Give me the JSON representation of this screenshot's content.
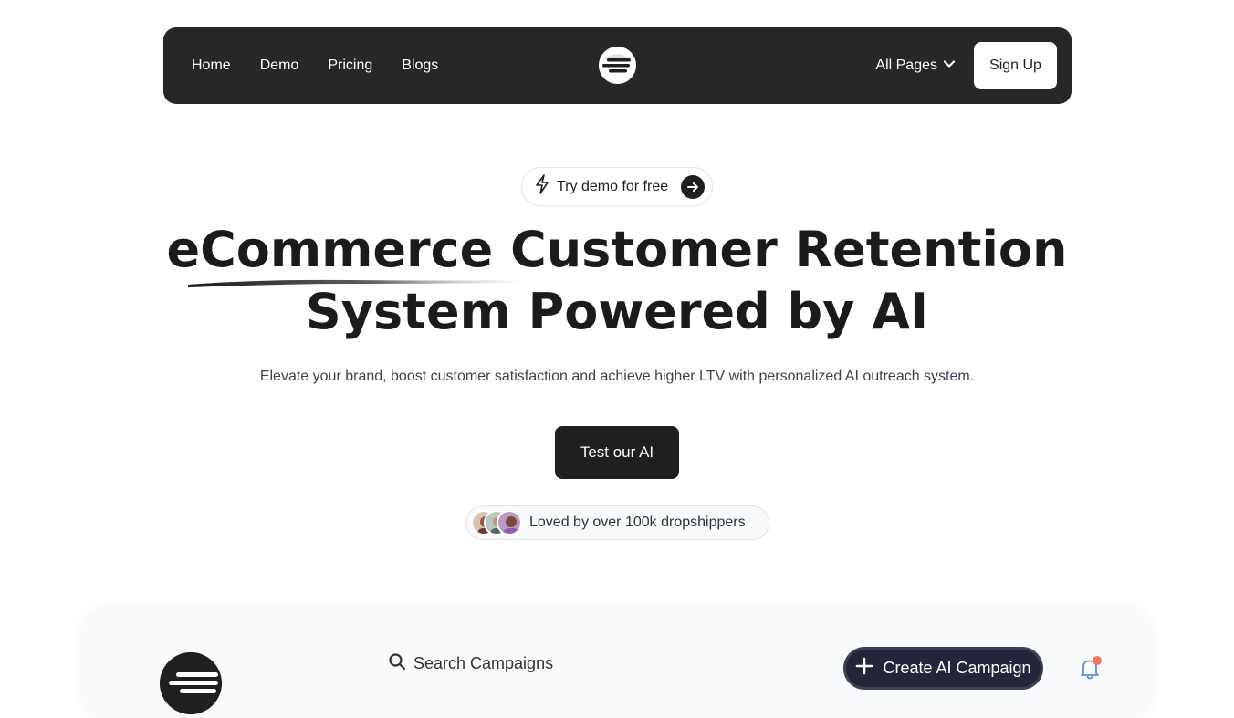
{
  "nav": {
    "links": [
      "Home",
      "Demo",
      "Pricing",
      "Blogs"
    ],
    "all_pages_label": "All Pages",
    "signup_label": "Sign Up"
  },
  "hero": {
    "demo_pill_label": "Try demo for free",
    "headline_line1": "eCommerce Customer Retention",
    "headline_line2": "System Powered by AI",
    "subtitle": "Elevate your brand, boost customer satisfaction and achieve higher LTV with personalized AI outreach system.",
    "cta_label": "Test our AI",
    "social_proof": "Loved by over 100k dropshippers"
  },
  "dashboard": {
    "search_placeholder": "Search Campaigns",
    "create_label": "Create AI Campaign"
  },
  "colors": {
    "nav_bg": "#272727",
    "accent_dark": "#1f1f1f",
    "create_btn_bg": "#222638",
    "notification_dot": "#f2785c",
    "bell_stroke": "#5b8fd6"
  },
  "icons": {
    "nav_logo": "brand-logo-icon",
    "all_pages": "chevron-down-icon",
    "demo_pill_left": "lightning-icon",
    "demo_pill_right": "arrow-right-icon",
    "search": "search-icon",
    "create": "plus-icon",
    "notifications": "bell-icon"
  }
}
